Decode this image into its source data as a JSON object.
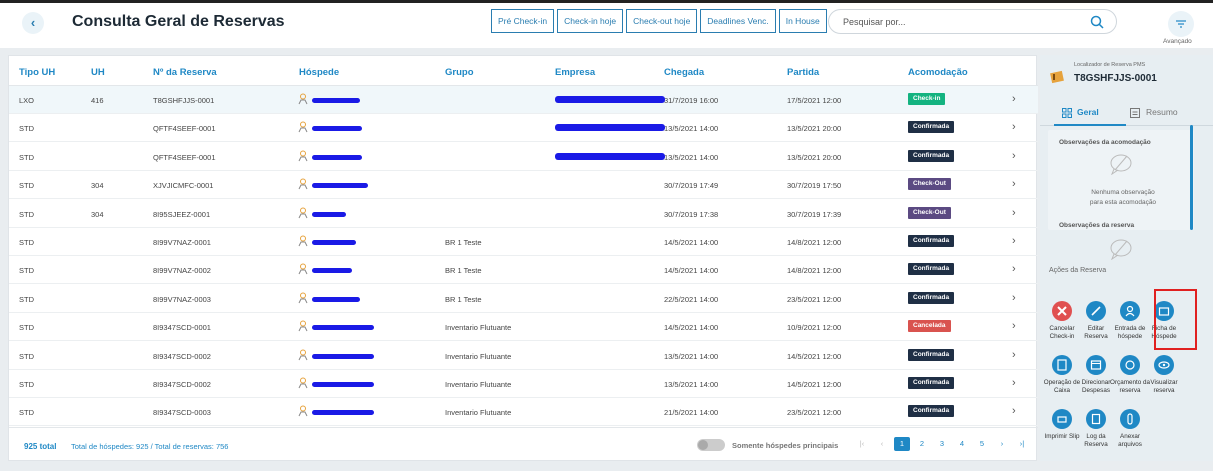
{
  "header": {
    "title": "Consulta Geral de Reservas",
    "quick_filters": [
      "Pré Check-in",
      "Check-in hoje",
      "Check-out hoje",
      "Deadlines Venc.",
      "In House"
    ],
    "search_placeholder": "Pesquisar por...",
    "advanced_label": "Avançado"
  },
  "table": {
    "columns": [
      "Tipo UH",
      "UH",
      "Nº da Reserva",
      "Hóspede",
      "Grupo",
      "Empresa",
      "Chegada",
      "Partida",
      "Acomodação"
    ],
    "rows": [
      {
        "tipo": "LXO",
        "uh": "416",
        "reserva": "T8GSHFJJS-0001",
        "grupo": "",
        "chegada": "31/7/2019 16:00",
        "partida": "17/5/2021 12:00",
        "status": "Check-in",
        "color": "#14b380",
        "selected": true
      },
      {
        "tipo": "STD",
        "uh": "",
        "reserva": "QFTF4SEEF-0001",
        "grupo": "",
        "chegada": "13/5/2021 14:00",
        "partida": "13/5/2021 20:00",
        "status": "Confirmada",
        "color": "#1f2f45"
      },
      {
        "tipo": "STD",
        "uh": "",
        "reserva": "QFTF4SEEF-0001",
        "grupo": "",
        "chegada": "13/5/2021 14:00",
        "partida": "13/5/2021 20:00",
        "status": "Confirmada",
        "color": "#1f2f45"
      },
      {
        "tipo": "STD",
        "uh": "304",
        "reserva": "XJVJICMFC-0001",
        "grupo": "",
        "chegada": "30/7/2019 17:49",
        "partida": "30/7/2019 17:50",
        "status": "Check-Out",
        "color": "#5b4a82"
      },
      {
        "tipo": "STD",
        "uh": "304",
        "reserva": "8I95SJEEZ-0001",
        "grupo": "",
        "chegada": "30/7/2019 17:38",
        "partida": "30/7/2019 17:39",
        "status": "Check-Out",
        "color": "#5b4a82"
      },
      {
        "tipo": "STD",
        "uh": "",
        "reserva": "8I99V7NAZ-0001",
        "grupo": "BR 1 Teste",
        "chegada": "14/5/2021 14:00",
        "partida": "14/8/2021 12:00",
        "status": "Confirmada",
        "color": "#1f2f45"
      },
      {
        "tipo": "STD",
        "uh": "",
        "reserva": "8I99V7NAZ-0002",
        "grupo": "BR 1 Teste",
        "chegada": "14/5/2021 14:00",
        "partida": "14/8/2021 12:00",
        "status": "Confirmada",
        "color": "#1f2f45"
      },
      {
        "tipo": "STD",
        "uh": "",
        "reserva": "8I99V7NAZ-0003",
        "grupo": "BR 1 Teste",
        "chegada": "22/5/2021 14:00",
        "partida": "23/5/2021 12:00",
        "status": "Confirmada",
        "color": "#1f2f45"
      },
      {
        "tipo": "STD",
        "uh": "",
        "reserva": "8I9347SCD-0001",
        "grupo": "Inventario Flutuante",
        "chegada": "14/5/2021 14:00",
        "partida": "10/9/2021 12:00",
        "status": "Cancelada",
        "color": "#d9534f"
      },
      {
        "tipo": "STD",
        "uh": "",
        "reserva": "8I9347SCD-0002",
        "grupo": "Inventario Flutuante",
        "chegada": "13/5/2021 14:00",
        "partida": "14/5/2021 12:00",
        "status": "Confirmada",
        "color": "#1f2f45"
      },
      {
        "tipo": "STD",
        "uh": "",
        "reserva": "8I9347SCD-0002",
        "grupo": "Inventario Flutuante",
        "chegada": "13/5/2021 14:00",
        "partida": "14/5/2021 12:00",
        "status": "Confirmada",
        "color": "#1f2f45"
      },
      {
        "tipo": "STD",
        "uh": "",
        "reserva": "8I9347SCD-0003",
        "grupo": "Inventario Flutuante",
        "chegada": "21/5/2021 14:00",
        "partida": "23/5/2021 12:00",
        "status": "Confirmada",
        "color": "#1f2f45"
      }
    ]
  },
  "footer": {
    "total": "925 total",
    "stats": "Total de hóspedes: 925 / Total de reservas: 756",
    "toggle_label": "Somente hóspedes principais",
    "pages": [
      "1",
      "2",
      "3",
      "4",
      "5"
    ]
  },
  "side": {
    "locator_label": "Localizador de Reserva PMS",
    "locator_code": "T8GSHFJJS-0001",
    "tab_geral": "Geral",
    "tab_resumo": "Resumo",
    "obs_accommodation": "Observações da acomodação",
    "obs_empty_1": "Nenhuma observação",
    "obs_empty_2": "para esta acomodação",
    "obs_reservation": "Observações da reserva",
    "actions_title": "Ações da Reserva",
    "actions": [
      {
        "label": "Cancelar Check-in",
        "icon": "close-icon",
        "color": "#e05050"
      },
      {
        "label": "Editar Reserva",
        "icon": "pencil-icon",
        "color": "#1f88c5"
      },
      {
        "label": "Entrada de hóspede",
        "icon": "user-add-icon",
        "color": "#1f88c5"
      },
      {
        "label": "Ficha de Hóspede",
        "icon": "folder-icon",
        "color": "#1f88c5"
      },
      {
        "label": "Operação de Caixa",
        "icon": "calculator-icon",
        "color": "#1f88c5"
      },
      {
        "label": "Direcionar Despesas",
        "icon": "calendar-icon",
        "color": "#1f88c5"
      },
      {
        "label": "Orçamento da reserva",
        "icon": "money-icon",
        "color": "#1f88c5"
      },
      {
        "label": "Visualizar reserva",
        "icon": "eye-icon",
        "color": "#1f88c5"
      },
      {
        "label": "Imprimir Slip",
        "icon": "printer-icon",
        "color": "#1f88c5"
      },
      {
        "label": "Log da Reserva",
        "icon": "document-icon",
        "color": "#1f88c5"
      },
      {
        "label": "Anexar arquivos",
        "icon": "paperclip-icon",
        "color": "#1f88c5"
      }
    ]
  }
}
